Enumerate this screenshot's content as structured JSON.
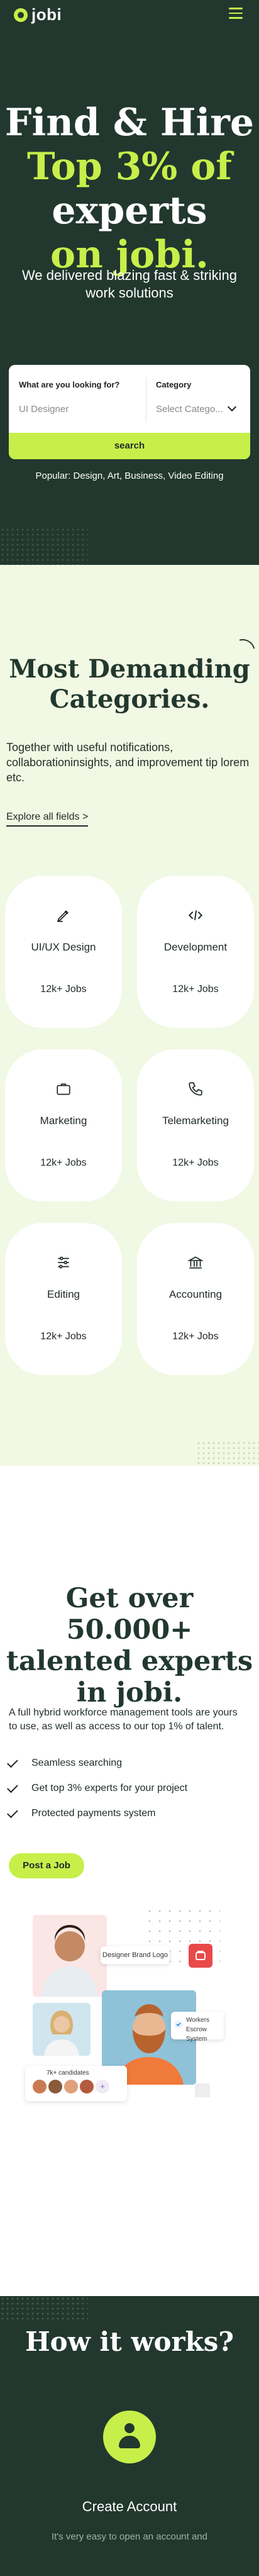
{
  "header": {
    "logo_text": "jobi",
    "menu_icon": "hamburger-icon",
    "accent_color": "#c7ef4a",
    "brand_color": "#22382e"
  },
  "hero": {
    "title_line1": "Find & Hire",
    "title_line2": "Top 3% of",
    "title_line3": "experts",
    "title_line4": "on jobi.",
    "subtitle": "We delivered blazing fast & striking work solutions",
    "search": {
      "what_label": "What are you looking for?",
      "what_placeholder": "UI Designer",
      "category_label": "Category",
      "category_placeholder": "Select Catego...",
      "button_label": "search"
    },
    "popular": "Popular: Design, Art, Business, Video Editing"
  },
  "categories": {
    "title": "Most Demanding Categories.",
    "description": "Together with useful notifications, collaborationinsights, and improvement tip lorem etc.",
    "link": "Explore all fields >",
    "items": [
      {
        "name": "UI/UX Design",
        "jobs": "12k+ Jobs",
        "icon": "pen-tool-icon"
      },
      {
        "name": "Development",
        "jobs": "12k+ Jobs",
        "icon": "code-icon"
      },
      {
        "name": "Marketing",
        "jobs": "12k+ Jobs",
        "icon": "briefcase-icon"
      },
      {
        "name": "Telemarketing",
        "jobs": "12k+ Jobs",
        "icon": "phone-icon"
      },
      {
        "name": "Editing",
        "jobs": "12k+ Jobs",
        "icon": "sliders-icon"
      },
      {
        "name": "Accounting",
        "jobs": "12k+ Jobs",
        "icon": "bank-icon"
      }
    ]
  },
  "experts": {
    "title": "Get over 50.000+ talented experts in jobi.",
    "description": "A full hybrid workforce management tools are yours to use, as well as access to our top 1% of talent.",
    "features": [
      "Seamless searching",
      "Get top 3% experts for your project",
      "Protected payments system"
    ],
    "button": "Post a Job",
    "chip_logo": "Designer Brand Logo",
    "chip_system": [
      "Workers",
      "Escrow System"
    ],
    "chip_candidates": "7k+ candidates"
  },
  "how": {
    "title": "How it works?",
    "step_title": "Create Account",
    "step_desc": "It's very easy to open an account and"
  }
}
